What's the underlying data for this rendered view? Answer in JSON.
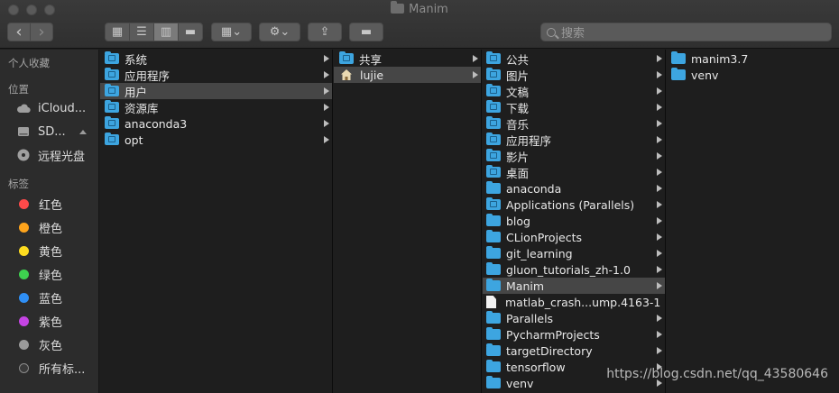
{
  "window": {
    "title": "Manim"
  },
  "toolbar": {
    "view_icons": [
      "▦",
      "☰",
      "▥",
      "▬"
    ],
    "group_icon": "▦⌄",
    "action_icon": "⚙⌄",
    "share_icon": "⇪",
    "tag_icon": "▬",
    "back_icon": "‹",
    "forward_icon": "›",
    "search_placeholder": "搜索"
  },
  "sidebar": {
    "favorites_header": "个人收藏",
    "locations_header": "位置",
    "locations": [
      {
        "label": "iCloud...",
        "icon": "cloud-icon"
      },
      {
        "label": "SD...",
        "icon": "disk-icon"
      },
      {
        "label": "远程光盘",
        "icon": "remote-disc-icon"
      }
    ],
    "tags_header": "标签",
    "tags": [
      {
        "label": "红色",
        "color": "#fe4a4a"
      },
      {
        "label": "橙色",
        "color": "#fea41c"
      },
      {
        "label": "黄色",
        "color": "#fedc20"
      },
      {
        "label": "绿色",
        "color": "#3ed14f"
      },
      {
        "label": "蓝色",
        "color": "#2f8ff5"
      },
      {
        "label": "紫色",
        "color": "#c544e3"
      },
      {
        "label": "灰色",
        "color": "#9a9a9a"
      },
      {
        "label": "所有标...",
        "color": "#3a3a3a"
      }
    ]
  },
  "columns": [
    {
      "items": [
        {
          "label": "系统",
          "has_children": true
        },
        {
          "label": "应用程序",
          "has_children": true
        },
        {
          "label": "用户",
          "has_children": true,
          "selected": true
        },
        {
          "label": "资源库",
          "has_children": true
        },
        {
          "label": "anaconda3",
          "has_children": true
        },
        {
          "label": "opt",
          "has_children": true
        }
      ]
    },
    {
      "items": [
        {
          "label": "共享",
          "has_children": true
        },
        {
          "label": "lujie",
          "has_children": true,
          "selected": true,
          "icon": "home"
        }
      ]
    },
    {
      "items": [
        {
          "label": "公共",
          "has_children": true
        },
        {
          "label": "图片",
          "has_children": true
        },
        {
          "label": "文稿",
          "has_children": true
        },
        {
          "label": "下载",
          "has_children": true
        },
        {
          "label": "音乐",
          "has_children": true
        },
        {
          "label": "应用程序",
          "has_children": true
        },
        {
          "label": "影片",
          "has_children": true
        },
        {
          "label": "桌面",
          "has_children": true
        },
        {
          "label": "anaconda",
          "has_children": true
        },
        {
          "label": "Applications (Parallels)",
          "has_children": true
        },
        {
          "label": "blog",
          "has_children": true
        },
        {
          "label": "CLionProjects",
          "has_children": true
        },
        {
          "label": "git_learning",
          "has_children": true
        },
        {
          "label": "gluon_tutorials_zh-1.0",
          "has_children": true
        },
        {
          "label": "Manim",
          "has_children": true,
          "selected": true
        },
        {
          "label": "matlab_crash...ump.4163-1",
          "has_children": false,
          "icon": "document"
        },
        {
          "label": "Parallels",
          "has_children": true
        },
        {
          "label": "PycharmProjects",
          "has_children": true
        },
        {
          "label": "targetDirectory",
          "has_children": true
        },
        {
          "label": "tensorflow",
          "has_children": true
        },
        {
          "label": "venv",
          "has_children": true
        }
      ]
    },
    {
      "items": [
        {
          "label": "manim3.7",
          "has_children": false
        },
        {
          "label": "venv",
          "has_children": false
        }
      ]
    }
  ],
  "watermark": "https://blog.csdn.net/qq_43580646"
}
